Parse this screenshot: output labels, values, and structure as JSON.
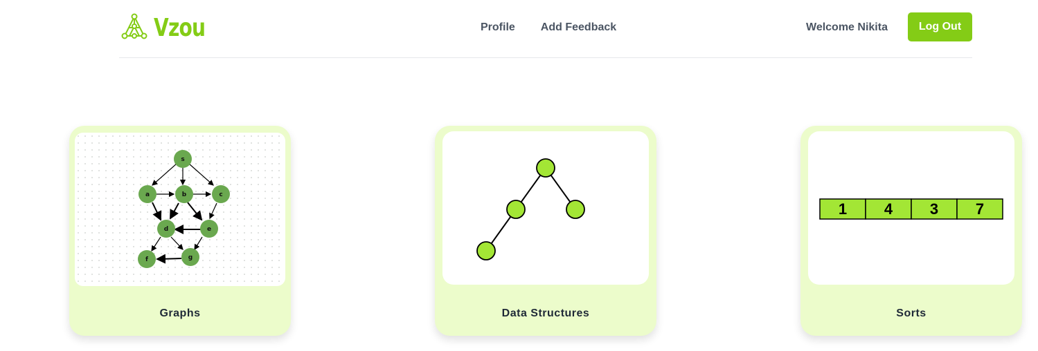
{
  "brand": {
    "name": "Vzou",
    "icon": "graph-triangle-logo-icon",
    "color": "#84cc16"
  },
  "nav": {
    "items": [
      "Profile",
      "Add Feedback"
    ]
  },
  "user": {
    "welcome": "Welcome Nikita",
    "logout_label": "Log Out"
  },
  "colors": {
    "accent": "#84cc16",
    "card_bg": "#ecfccb",
    "node_green": "#6aa84f",
    "node_lime": "#a3e635"
  },
  "cards": [
    {
      "label": "Graphs",
      "preview": {
        "type": "directed-graph",
        "nodes": [
          "s",
          "a",
          "b",
          "c",
          "d",
          "e",
          "f",
          "g"
        ],
        "edges": [
          [
            "s",
            "a"
          ],
          [
            "s",
            "b"
          ],
          [
            "s",
            "c"
          ],
          [
            "a",
            "b"
          ],
          [
            "b",
            "c"
          ],
          [
            "a",
            "d"
          ],
          [
            "b",
            "d"
          ],
          [
            "b",
            "e"
          ],
          [
            "c",
            "e"
          ],
          [
            "e",
            "d"
          ],
          [
            "d",
            "f"
          ],
          [
            "d",
            "g"
          ],
          [
            "e",
            "g"
          ],
          [
            "g",
            "f"
          ]
        ]
      }
    },
    {
      "label": "Data Structures",
      "preview": {
        "type": "binary-tree",
        "nodes": 4
      }
    },
    {
      "label": "Sorts",
      "preview": {
        "type": "array",
        "values": [
          "1",
          "4",
          "3",
          "7"
        ]
      }
    }
  ]
}
